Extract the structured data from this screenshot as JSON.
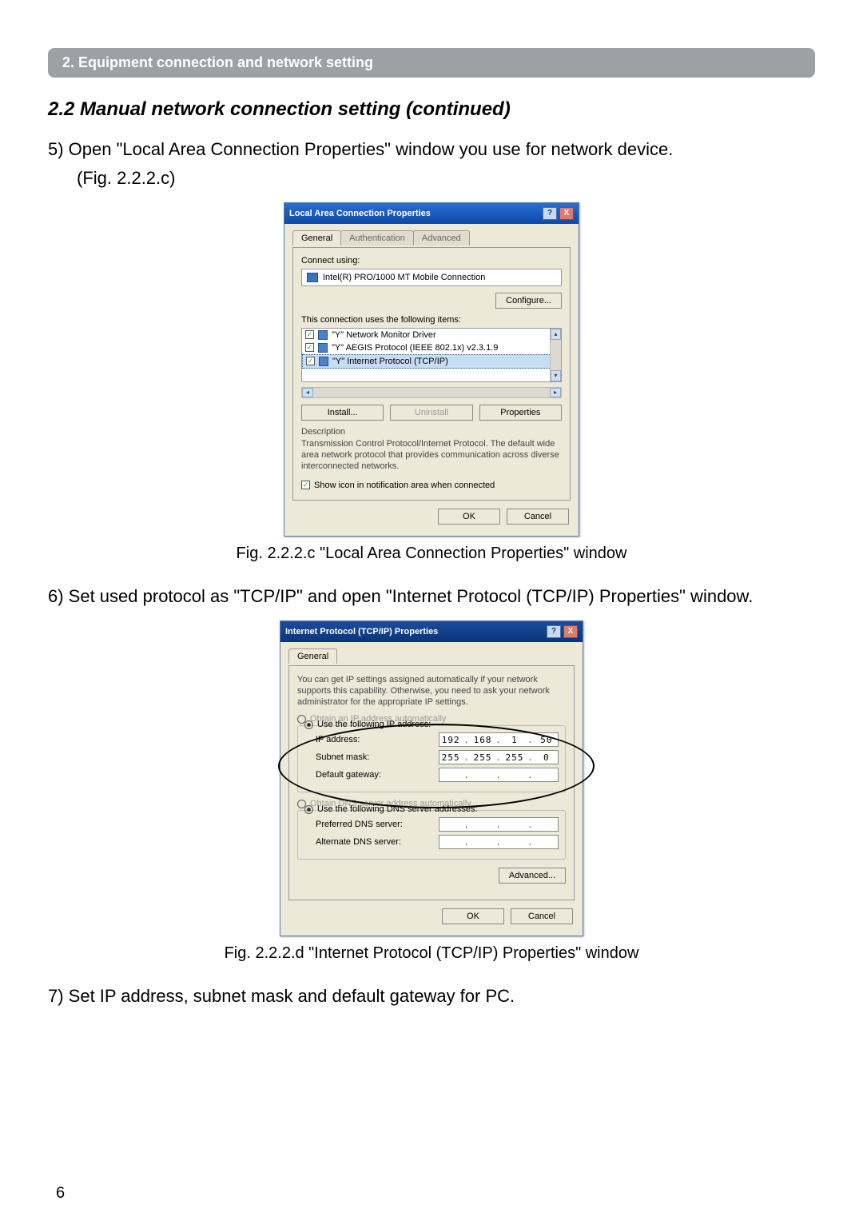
{
  "bar": "2. Equipment connection and network setting",
  "heading": "2.2 Manual network connection setting (continued)",
  "steps": {
    "s5a": "5) Open \"Local Area Connection Properties\" window you use for network device.",
    "s5b": "(Fig. 2.2.2.c)",
    "s6": "6) Set used protocol as \"TCP/IP\" and open \"Internet Protocol (TCP/IP) Properties\" window.",
    "s7": "7) Set IP address, subnet mask and default gateway for PC."
  },
  "figcap1": "Fig. 2.2.2.c \"Local Area Connection Properties\" window",
  "figcap2": "Fig. 2.2.2.d \"Internet Protocol (TCP/IP) Properties\" window",
  "page_num": "6",
  "dlg1": {
    "title": "Local Area Connection Properties",
    "help": "?",
    "close": "X",
    "tabs": {
      "general": "General",
      "auth": "Authentication",
      "adv": "Advanced"
    },
    "connect_using": "Connect using:",
    "adapter": "Intel(R) PRO/1000 MT Mobile Connection",
    "configure": "Configure...",
    "uses_items": "This connection uses the following items:",
    "items": {
      "i1": "\"Y\" Network Monitor Driver",
      "i2": "\"Y\" AEGIS Protocol (IEEE 802.1x) v2.3.1.9",
      "i3": "\"Y\" Internet Protocol (TCP/IP)"
    },
    "btns": {
      "install": "Install...",
      "uninstall": "Uninstall",
      "props": "Properties"
    },
    "desc_lbl": "Description",
    "desc_text": "Transmission Control Protocol/Internet Protocol. The default wide area network protocol that provides communication across diverse interconnected networks.",
    "show_icon": "Show icon in notification area when connected",
    "ok": "OK",
    "cancel": "Cancel"
  },
  "dlg2": {
    "title": "Internet Protocol (TCP/IP) Properties",
    "help": "?",
    "close": "X",
    "tab_general": "General",
    "intro": "You can get IP settings assigned automatically if your network supports this capability. Otherwise, you need to ask your network administrator for the appropriate IP settings.",
    "r_auto": "Obtain an IP address automatically",
    "r_use": "Use the following IP address:",
    "ip_lbl": "IP address:",
    "ip": {
      "a": "192",
      "b": "168",
      "c": "1",
      "d": "50"
    },
    "sn_lbl": "Subnet mask:",
    "sn": {
      "a": "255",
      "b": "255",
      "c": "255",
      "d": "0"
    },
    "gw_lbl": "Default gateway:",
    "r_dns_auto": "Obtain DNS server address automatically",
    "r_dns_use": "Use the following DNS server addresses:",
    "pdns_lbl": "Preferred DNS server:",
    "adns_lbl": "Alternate DNS server:",
    "advanced": "Advanced...",
    "ok": "OK",
    "cancel": "Cancel"
  }
}
